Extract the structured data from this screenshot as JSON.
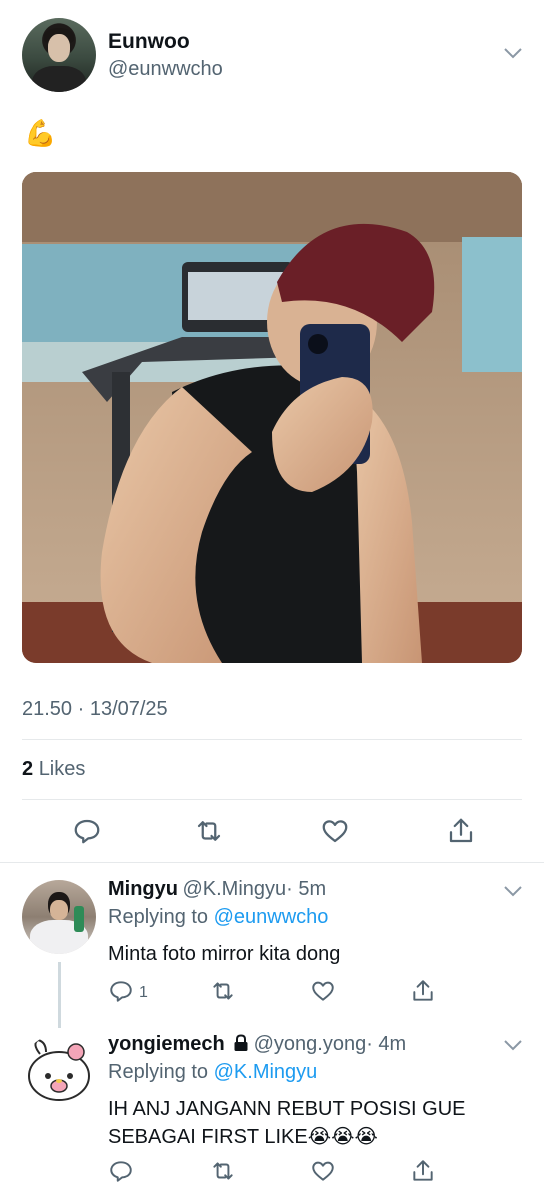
{
  "main_tweet": {
    "display_name": "Eunwoo",
    "handle": "@eunwwcho",
    "text": "💪",
    "timestamp": "21.50 · 13/07/25",
    "likes_count": "2",
    "likes_label": "Likes",
    "icons": [
      "reply-icon",
      "retweet-icon",
      "like-icon",
      "share-icon"
    ]
  },
  "replies": [
    {
      "display_name": "Mingyu",
      "handle": "@K.Mingyu",
      "time": "· 5m",
      "replying_prefix": "Replying to",
      "replying_to": "@eunwwcho",
      "text": "Minta foto mirror kita dong",
      "reply_count": "1"
    },
    {
      "display_name": "yongiemech",
      "handle": "@yong.yong",
      "time": "· 4m",
      "replying_prefix": "Replying to",
      "replying_to": "@K.Mingyu",
      "text_line1": "IH ANJ JANGANN REBUT POSISI GUE",
      "text_line2": "SEBAGAI FIRST LIKE",
      "emojis": "😭😭😭"
    }
  ],
  "colors": {
    "link": "#1d9bf0",
    "secondary": "#536471",
    "divider": "#e6e9eb"
  }
}
